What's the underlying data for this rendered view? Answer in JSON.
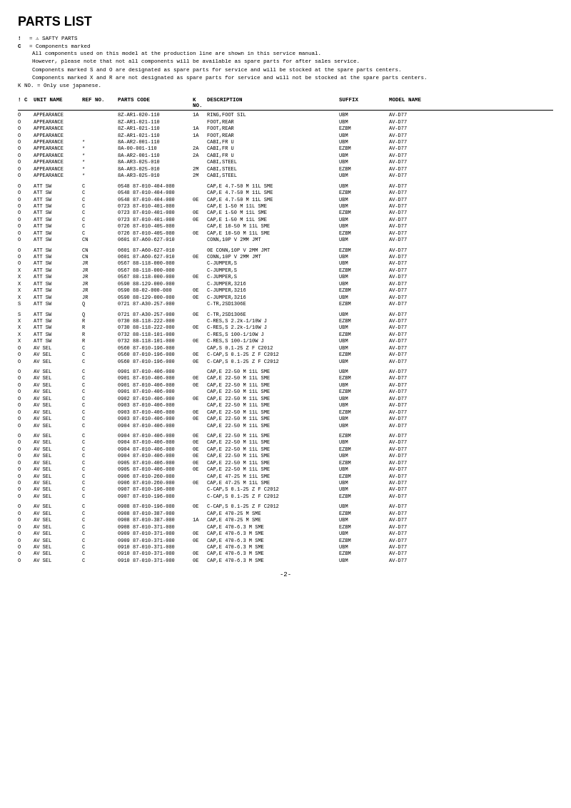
{
  "title": "PARTS LIST",
  "legend": {
    "symbol1": "!",
    "desc1": "= ⚠ SAFTY PARTS",
    "symbol2": "C",
    "desc2": "= Components marked",
    "note1": "All components used on this model at the production line are shown in this service manual.",
    "note2": "However, please note that not all components will be available as spare parts for after sales service.",
    "note3": "Components marked S and O are designated as spare parts for service and will be stocked at the spare parts centers.",
    "note4": "Components marked X and R are not designated as spare parts for service and will not be stocked at the spare parts centers.",
    "note5": "K NO. = Only use japanese."
  },
  "table_headers": {
    "ic": "! C",
    "unit": "UNIT NAME",
    "ref": "REF NO.",
    "parts": "PARTS CODE",
    "kno": "K NO.",
    "desc": "DESCRIPTION",
    "suffix": "SUFFIX",
    "model": "MODEL NAME"
  },
  "rows": [
    {
      "ic": "O",
      "unit": "APPEARANCE",
      "ref": "",
      "parts": "8Z-AR1-020-110",
      "kno": "1A",
      "desc": "RING,FOOT SIL",
      "suffix": "UBM",
      "model": "AV-D77"
    },
    {
      "ic": "O",
      "unit": "APPEARANCE",
      "ref": "",
      "parts": "8Z-AR1-021-110",
      "kno": "",
      "desc": "FOOT,REAR",
      "suffix": "UBM",
      "model": "AV-D77"
    },
    {
      "ic": "O",
      "unit": "APPEARANCE",
      "ref": "",
      "parts": "8Z-AR1-021-110",
      "kno": "1A",
      "desc": "FOOT,REAR",
      "suffix": "EZBM",
      "model": "AV-D77"
    },
    {
      "ic": "O",
      "unit": "APPEARANCE",
      "ref": "",
      "parts": "8Z-AR1-021-110",
      "kno": "1A",
      "desc": "FOOT,REAR",
      "suffix": "UBM",
      "model": "AV-D77"
    },
    {
      "ic": "O",
      "unit": "APPEARANCE",
      "ref": "*",
      "parts": "8A-AR2-001-110",
      "kno": "",
      "desc": "CABI,FR U",
      "suffix": "UBM",
      "model": "AV-D77"
    },
    {
      "ic": "O",
      "unit": "APPEARANCE",
      "ref": "*",
      "parts": "8A-00-001-110",
      "kno": "2A",
      "desc": "CABI,FR U",
      "suffix": "EZBM",
      "model": "AV-D77"
    },
    {
      "ic": "O",
      "unit": "APPEARANCE",
      "ref": "*",
      "parts": "8A-AR2-001-110",
      "kno": "2A",
      "desc": "CABI,FR U",
      "suffix": "UBM",
      "model": "AV-D77"
    },
    {
      "ic": "O",
      "unit": "APPEARANCE",
      "ref": "*",
      "parts": "8A-AR3-025-010",
      "kno": "",
      "desc": "CABI,STEEL",
      "suffix": "UBM",
      "model": "AV-D77"
    },
    {
      "ic": "O",
      "unit": "APPEARANCE",
      "ref": "*",
      "parts": "8A-AR3-025-010",
      "kno": "2M",
      "desc": "CABI,STEEL",
      "suffix": "EZBM",
      "model": "AV-D77"
    },
    {
      "ic": "O",
      "unit": "APPEARANCE",
      "ref": "*",
      "parts": "8A-AR3-025-010",
      "kno": "2M",
      "desc": "CABI,STEEL",
      "suffix": "UBM",
      "model": "AV-D77"
    },
    {
      "ic": "",
      "unit": "",
      "ref": "",
      "parts": "",
      "kno": "",
      "desc": "",
      "suffix": "",
      "model": ""
    },
    {
      "ic": "O",
      "unit": "ATT SW",
      "ref": "C",
      "parts": "0548 87-010-404-080",
      "kno": "",
      "desc": "CAP,E 4.7-50 M 11L SME",
      "suffix": "UBM",
      "model": "AV-D77"
    },
    {
      "ic": "O",
      "unit": "ATT SW",
      "ref": "C",
      "parts": "0548 87-010-404-080",
      "kno": "",
      "desc": "CAP,E 4.7-50 M 11L SME",
      "suffix": "EZBM",
      "model": "AV-D77"
    },
    {
      "ic": "O",
      "unit": "ATT SW",
      "ref": "C",
      "parts": "0548 87-010-404-080",
      "kno": "0E",
      "desc": "CAP,E 4.7-50 M 11L SME",
      "suffix": "UBM",
      "model": "AV-D77"
    },
    {
      "ic": "O",
      "unit": "ATT SW",
      "ref": "C",
      "parts": "0723 87-010-401-080",
      "kno": "",
      "desc": "CAP,E 1-50 M 11L SME",
      "suffix": "UBM",
      "model": "AV-D77"
    },
    {
      "ic": "O",
      "unit": "ATT SW",
      "ref": "C",
      "parts": "0723 87-010-401-080",
      "kno": "0E",
      "desc": "CAP,E 1-50 M 11L SME",
      "suffix": "EZBM",
      "model": "AV-D77"
    },
    {
      "ic": "O",
      "unit": "ATT SW",
      "ref": "C",
      "parts": "0723 87-010-401-080",
      "kno": "0E",
      "desc": "CAP,E 1-50 M 11L SME",
      "suffix": "UBM",
      "model": "AV-D77"
    },
    {
      "ic": "O",
      "unit": "ATT SW",
      "ref": "C",
      "parts": "0726 87-010-405-080",
      "kno": "",
      "desc": "CAP,E 10-50 M 11L SME",
      "suffix": "UBM",
      "model": "AV-D77"
    },
    {
      "ic": "O",
      "unit": "ATT SW",
      "ref": "C",
      "parts": "0726 87-010-405-080",
      "kno": "0E",
      "desc": "CAP,E 10-50 M 11L SME",
      "suffix": "EZBM",
      "model": "AV-D77"
    },
    {
      "ic": "O",
      "unit": "ATT SW",
      "ref": "CN",
      "parts": "0601 87-A60-627-010",
      "kno": "",
      "desc": "CONN,10P V 2MM JMT",
      "suffix": "UBM",
      "model": "AV-D77"
    },
    {
      "ic": "",
      "unit": "",
      "ref": "",
      "parts": "",
      "kno": "",
      "desc": "",
      "suffix": "",
      "model": ""
    },
    {
      "ic": "O",
      "unit": "ATT SW",
      "ref": "CN",
      "parts": "0601 87-A60-627-010",
      "kno": "",
      "desc": "0E CONN,10P V 2MM JMT",
      "suffix": "EZBM",
      "model": "AV-D77"
    },
    {
      "ic": "O",
      "unit": "ATT SW",
      "ref": "CN",
      "parts": "0601 87-A60-627-010",
      "kno": "0E",
      "desc": "CONN,10P V 2MM JMT",
      "suffix": "UBM",
      "model": "AV-D77"
    },
    {
      "ic": "O",
      "unit": "ATT SW",
      "ref": "JR",
      "parts": "0567 88-118-000-080",
      "kno": "",
      "desc": "C-JUMPER,S",
      "suffix": "UBM",
      "model": "AV-D77"
    },
    {
      "ic": "X",
      "unit": "ATT SW",
      "ref": "JR",
      "parts": "0567 88-118-000-080",
      "kno": "",
      "desc": "C-JUMPER,S",
      "suffix": "EZBM",
      "model": "AV-D77"
    },
    {
      "ic": "X",
      "unit": "ATT SW",
      "ref": "JR",
      "parts": "0567 88-118-000-080",
      "kno": "0E",
      "desc": "C-JUMPER,S",
      "suffix": "UBM",
      "model": "AV-D77"
    },
    {
      "ic": "X",
      "unit": "ATT SW",
      "ref": "JR",
      "parts": "0590 88-129-000-080",
      "kno": "",
      "desc": "C-JUMPER,3216",
      "suffix": "UBM",
      "model": "AV-D77"
    },
    {
      "ic": "X",
      "unit": "ATT SW",
      "ref": "JR",
      "parts": "0590 88-02-000-080",
      "kno": "0E",
      "desc": "C-JUMPER,3216",
      "suffix": "EZBM",
      "model": "AV-D77"
    },
    {
      "ic": "X",
      "unit": "ATT SW",
      "ref": "JR",
      "parts": "0590 88-129-000-080",
      "kno": "0E",
      "desc": "C-JUMPER,3216",
      "suffix": "UBM",
      "model": "AV-D77"
    },
    {
      "ic": "S",
      "unit": "ATT SW",
      "ref": "Q",
      "parts": "0721 87-A30-257-080",
      "kno": "",
      "desc": "C-TR,2SD1306E",
      "suffix": "EZBM",
      "model": "AV-D77"
    },
    {
      "ic": "",
      "unit": "",
      "ref": "",
      "parts": "",
      "kno": "",
      "desc": "",
      "suffix": "",
      "model": ""
    },
    {
      "ic": "S",
      "unit": "ATT SW",
      "ref": "Q",
      "parts": "0721 87-A30-257-080",
      "kno": "0E",
      "desc": "C-TR,2SD1306E",
      "suffix": "UBM",
      "model": "AV-D77"
    },
    {
      "ic": "X",
      "unit": "ATT SW",
      "ref": "R",
      "parts": "0730 88-118-222-080",
      "kno": "",
      "desc": "C-RES,S 2.2k-1/10W J",
      "suffix": "EZBM",
      "model": "AV-D77"
    },
    {
      "ic": "X",
      "unit": "ATT SW",
      "ref": "R",
      "parts": "0730 88-118-222-080",
      "kno": "0E",
      "desc": "C-RES,S 2.2k-1/10W J",
      "suffix": "UBM",
      "model": "AV-D77"
    },
    {
      "ic": "X",
      "unit": "ATT SW",
      "ref": "R",
      "parts": "0732 88-118-101-080",
      "kno": "",
      "desc": "C-RES,S 100-1/10W J",
      "suffix": "EZBM",
      "model": "AV-D77"
    },
    {
      "ic": "X",
      "unit": "ATT SW",
      "ref": "R",
      "parts": "0732 88-118-101-080",
      "kno": "0E",
      "desc": "C-RES,S 100-1/10W J",
      "suffix": "UBM",
      "model": "AV-D77"
    },
    {
      "ic": "O",
      "unit": "AV SEL",
      "ref": "C",
      "parts": "0560 87-010-196-080",
      "kno": "",
      "desc": "CAP,S 0.1-25 Z F C2012",
      "suffix": "UBM",
      "model": "AV-D77"
    },
    {
      "ic": "O",
      "unit": "AV SEL",
      "ref": "C",
      "parts": "0560 87-010-196-080",
      "kno": "0E",
      "desc": "C-CAP,S 0.1-25 Z F C2012",
      "suffix": "EZBM",
      "model": "AV-D77"
    },
    {
      "ic": "O",
      "unit": "AV SEL",
      "ref": "C",
      "parts": "0560 87-010-196-080",
      "kno": "0E",
      "desc": "C-CAP,S 0.1-25 Z F C2012",
      "suffix": "UBM",
      "model": "AV-D77"
    },
    {
      "ic": "",
      "unit": "",
      "ref": "",
      "parts": "",
      "kno": "",
      "desc": "",
      "suffix": "",
      "model": ""
    },
    {
      "ic": "O",
      "unit": "AV SEL",
      "ref": "C",
      "parts": "0901 87-010-406-080",
      "kno": "",
      "desc": "CAP,E 22-50 M 11L SME",
      "suffix": "UBM",
      "model": "AV-D77"
    },
    {
      "ic": "O",
      "unit": "AV SEL",
      "ref": "C",
      "parts": "0901 87-010-406-080",
      "kno": "0E",
      "desc": "CAP,E 22-50 M 11L SME",
      "suffix": "EZBM",
      "model": "AV-D77"
    },
    {
      "ic": "O",
      "unit": "AV SEL",
      "ref": "C",
      "parts": "0901 87-010-406-080",
      "kno": "0E",
      "desc": "CAP,E 22-50 M 11L SME",
      "suffix": "UBM",
      "model": "AV-D77"
    },
    {
      "ic": "O",
      "unit": "AV SEL",
      "ref": "C",
      "parts": "0901 87-010-406-080",
      "kno": "",
      "desc": "CAP,E 22-50 M 11L SME",
      "suffix": "EZBM",
      "model": "AV-D77"
    },
    {
      "ic": "O",
      "unit": "AV SEL",
      "ref": "C",
      "parts": "0902 87-010-406-080",
      "kno": "0E",
      "desc": "CAP,E 22-50 M 11L SME",
      "suffix": "UBM",
      "model": "AV-D77"
    },
    {
      "ic": "O",
      "unit": "AV SEL",
      "ref": "C",
      "parts": "0903 87-010-406-080",
      "kno": "",
      "desc": "CAP,E 22-50 M 11L SME",
      "suffix": "UBM",
      "model": "AV-D77"
    },
    {
      "ic": "O",
      "unit": "AV SEL",
      "ref": "C",
      "parts": "0903 87-010-406-080",
      "kno": "0E",
      "desc": "CAP,E 22-50 M 11L SME",
      "suffix": "EZBM",
      "model": "AV-D77"
    },
    {
      "ic": "O",
      "unit": "AV SEL",
      "ref": "C",
      "parts": "0903 87-010-406-080",
      "kno": "0E",
      "desc": "CAP,E 22-50 M 11L SME",
      "suffix": "UBM",
      "model": "AV-D77"
    },
    {
      "ic": "O",
      "unit": "AV SEL",
      "ref": "C",
      "parts": "0904 87-010-406-080",
      "kno": "",
      "desc": "CAP,E 22-50 M 11L SME",
      "suffix": "UBM",
      "model": "AV-D77"
    },
    {
      "ic": "",
      "unit": "",
      "ref": "",
      "parts": "",
      "kno": "",
      "desc": "",
      "suffix": "",
      "model": ""
    },
    {
      "ic": "O",
      "unit": "AV SEL",
      "ref": "C",
      "parts": "0904 87-010-406-080",
      "kno": "0E",
      "desc": "CAP,E 22-50 M 11L SME",
      "suffix": "EZBM",
      "model": "AV-D77"
    },
    {
      "ic": "O",
      "unit": "AV SEL",
      "ref": "C",
      "parts": "0904 87-010-406-080",
      "kno": "0E",
      "desc": "CAP,E 22-50 M 11L SME",
      "suffix": "UBM",
      "model": "AV-D77"
    },
    {
      "ic": "O",
      "unit": "AV SEL",
      "ref": "C",
      "parts": "0904 87-010-406-080",
      "kno": "0E",
      "desc": "CAP,E 22-50 M 11L SME",
      "suffix": "EZBM",
      "model": "AV-D77"
    },
    {
      "ic": "O",
      "unit": "AV SEL",
      "ref": "C",
      "parts": "0904 87-010-406-080",
      "kno": "0E",
      "desc": "CAP,E 22-50 M 11L SME",
      "suffix": "UBM",
      "model": "AV-D77"
    },
    {
      "ic": "O",
      "unit": "AV SEL",
      "ref": "C",
      "parts": "0905 87-010-406-080",
      "kno": "0E",
      "desc": "CAP,E 22-50 M 11L SME",
      "suffix": "EZBM",
      "model": "AV-D77"
    },
    {
      "ic": "O",
      "unit": "AV SEL",
      "ref": "C",
      "parts": "0905 87-010-406-080",
      "kno": "0E",
      "desc": "CAP,E 22-50 M 11L SME",
      "suffix": "UBM",
      "model": "AV-D77"
    },
    {
      "ic": "O",
      "unit": "AV SEL",
      "ref": "C",
      "parts": "0906 87-010-260-080",
      "kno": "",
      "desc": "CAP,E 47-25 M 11L SME",
      "suffix": "EZBM",
      "model": "AV-D77"
    },
    {
      "ic": "O",
      "unit": "AV SEL",
      "ref": "C",
      "parts": "0906 87-010-260-080",
      "kno": "0E",
      "desc": "CAP,E 47-25 M 11L SME",
      "suffix": "UBM",
      "model": "AV-D77"
    },
    {
      "ic": "O",
      "unit": "AV SEL",
      "ref": "C",
      "parts": "0907 87-010-196-080",
      "kno": "",
      "desc": "C-CAP,S 0.1-25 Z F C2012",
      "suffix": "UBM",
      "model": "AV-D77"
    },
    {
      "ic": "O",
      "unit": "AV SEL",
      "ref": "C",
      "parts": "0907 87-010-196-080",
      "kno": "",
      "desc": "C-CAP,S 0.1-25 Z F C2012",
      "suffix": "EZBM",
      "model": "AV-D77"
    },
    {
      "ic": "",
      "unit": "",
      "ref": "",
      "parts": "",
      "kno": "",
      "desc": "",
      "suffix": "",
      "model": ""
    },
    {
      "ic": "O",
      "unit": "AV SEL",
      "ref": "C",
      "parts": "0908 87-010-196-080",
      "kno": "0E",
      "desc": "C-CAP,S 0.1-25 Z F C2012",
      "suffix": "UBM",
      "model": "AV-D77"
    },
    {
      "ic": "O",
      "unit": "AV SEL",
      "ref": "C",
      "parts": "0908 87-010-387-080",
      "kno": "",
      "desc": "CAP,E 470-25 M SME",
      "suffix": "EZBM",
      "model": "AV-D77"
    },
    {
      "ic": "O",
      "unit": "AV SEL",
      "ref": "C",
      "parts": "0908 87-010-387-080",
      "kno": "1A",
      "desc": "CAP,E 470-25 M SME",
      "suffix": "UBM",
      "model": "AV-D77"
    },
    {
      "ic": "O",
      "unit": "AV SEL",
      "ref": "C",
      "parts": "0908 87-010-371-080",
      "kno": "",
      "desc": "CAP,E 470-6.3 M SME",
      "suffix": "EZBM",
      "model": "AV-D77"
    },
    {
      "ic": "O",
      "unit": "AV SEL",
      "ref": "C",
      "parts": "0909 87-010-371-080",
      "kno": "0E",
      "desc": "CAP,E 470-6.3 M SME",
      "suffix": "UBM",
      "model": "AV-D77"
    },
    {
      "ic": "O",
      "unit": "AV SEL",
      "ref": "C",
      "parts": "0909 87-010-371-080",
      "kno": "0E",
      "desc": "CAP,E 470-6.3 M SME",
      "suffix": "EZBM",
      "model": "AV-D77"
    },
    {
      "ic": "O",
      "unit": "AV SEL",
      "ref": "C",
      "parts": "0910 87-010-371-080",
      "kno": "",
      "desc": "CAP,E 470-6.3 M SME",
      "suffix": "UBM",
      "model": "AV-D77"
    },
    {
      "ic": "O",
      "unit": "AV SEL",
      "ref": "C",
      "parts": "0910 87-010-371-080",
      "kno": "0E",
      "desc": "CAP,E 470-6.3 M SME",
      "suffix": "EZBM",
      "model": "AV-D77"
    },
    {
      "ic": "O",
      "unit": "AV SEL",
      "ref": "C",
      "parts": "0910 87-010-371-080",
      "kno": "0E",
      "desc": "CAP,E 470-6.3 M SME",
      "suffix": "UBM",
      "model": "AV-D77"
    }
  ],
  "page_number": "-2-"
}
